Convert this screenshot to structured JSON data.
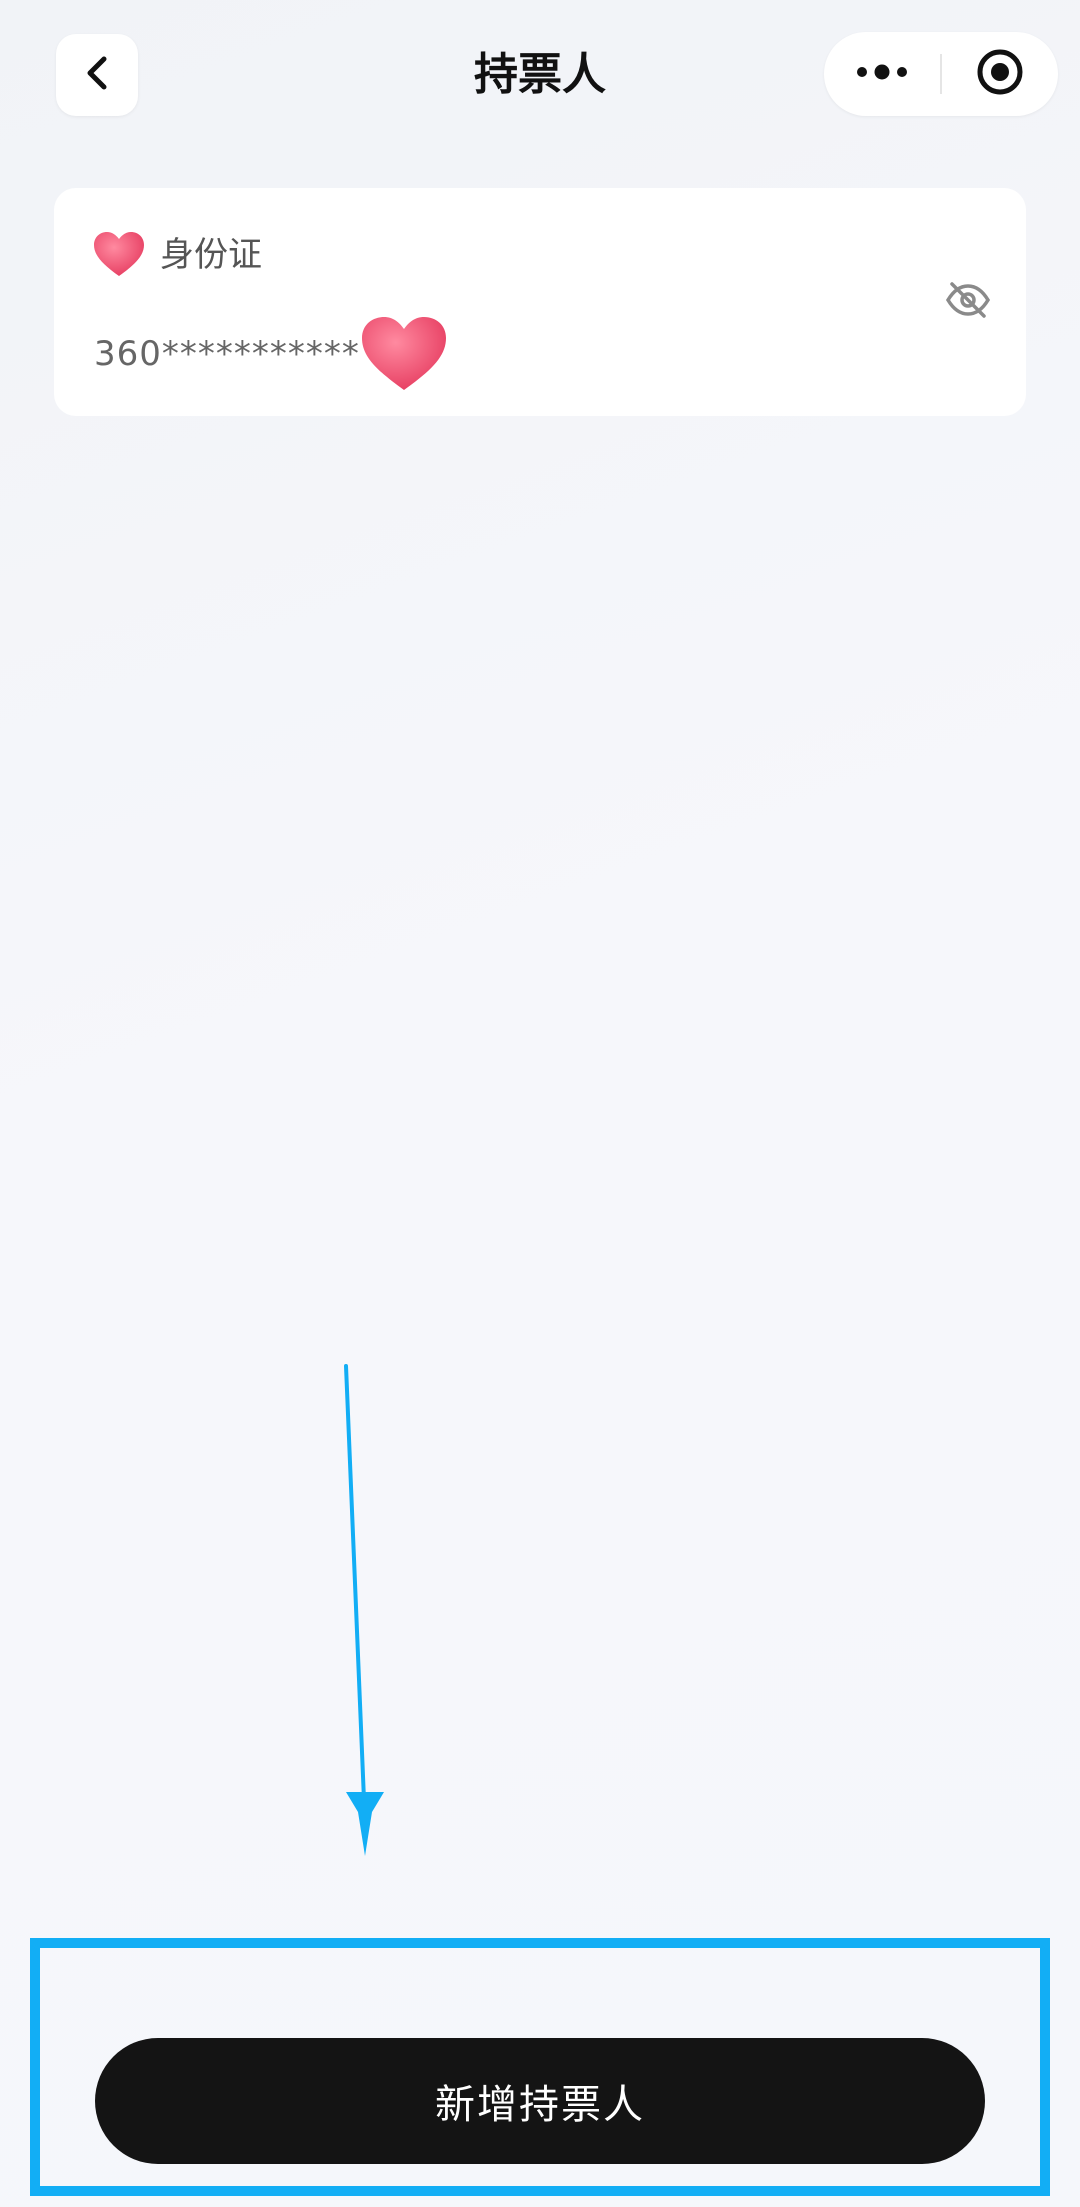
{
  "nav": {
    "title": "持票人",
    "back_icon": "chevron-left-icon",
    "more_icon": "more-dots-icon",
    "close_icon": "target-circle-icon"
  },
  "holder": {
    "id_type": "身份证",
    "id_number_masked": "360***********",
    "visibility_icon": "eye-off-icon",
    "redaction_icon": "heart-icon"
  },
  "actions": {
    "add_holder_label": "新增持票人"
  },
  "colors": {
    "highlight": "#12aef5",
    "button_bg": "#141414",
    "heart": "#f0506e"
  }
}
